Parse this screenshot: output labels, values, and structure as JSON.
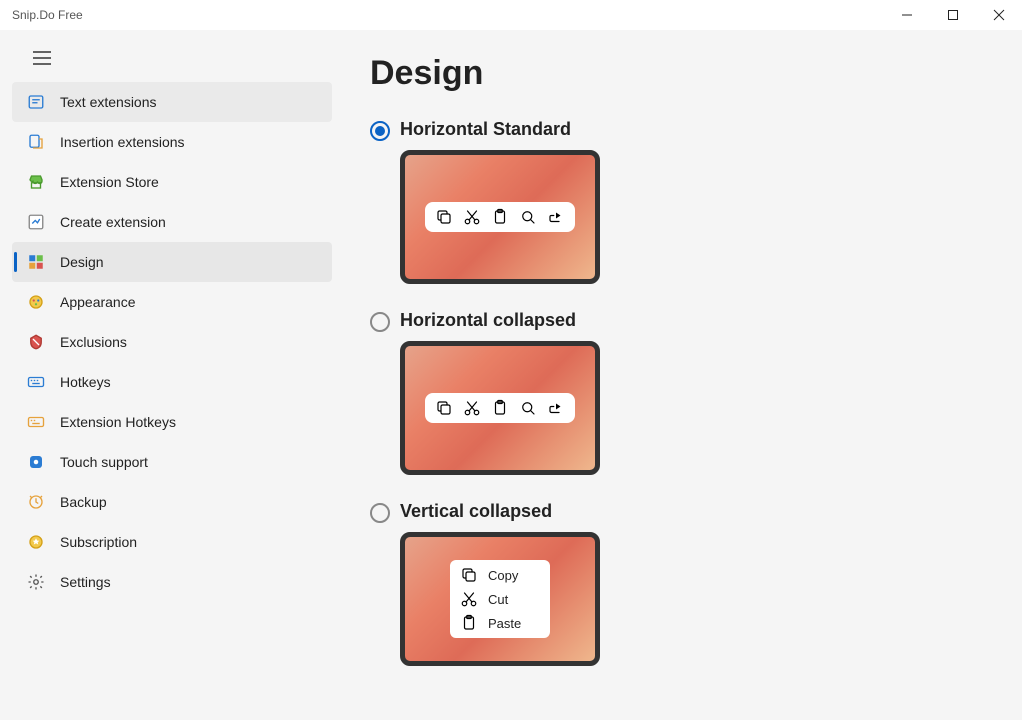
{
  "window": {
    "title": "Snip.Do Free"
  },
  "sidebar": {
    "items": [
      {
        "label": "Text extensions",
        "icon": "text-ext",
        "state": "hover"
      },
      {
        "label": "Insertion extensions",
        "icon": "insert-ext",
        "state": ""
      },
      {
        "label": "Extension Store",
        "icon": "store",
        "state": ""
      },
      {
        "label": "Create extension",
        "icon": "create",
        "state": ""
      },
      {
        "label": "Design",
        "icon": "design",
        "state": "selected"
      },
      {
        "label": "Appearance",
        "icon": "appearance",
        "state": ""
      },
      {
        "label": "Exclusions",
        "icon": "exclusions",
        "state": ""
      },
      {
        "label": "Hotkeys",
        "icon": "hotkeys",
        "state": ""
      },
      {
        "label": "Extension Hotkeys",
        "icon": "ext-hotkeys",
        "state": ""
      },
      {
        "label": "Touch support",
        "icon": "touch",
        "state": ""
      },
      {
        "label": "Backup",
        "icon": "backup",
        "state": ""
      },
      {
        "label": "Subscription",
        "icon": "subscription",
        "state": ""
      },
      {
        "label": "Settings",
        "icon": "settings",
        "state": ""
      }
    ]
  },
  "main": {
    "title": "Design",
    "options": [
      {
        "label": "Horizontal Standard",
        "selected": true,
        "preview": "horizontal"
      },
      {
        "label": "Horizontal collapsed",
        "selected": false,
        "preview": "horizontal"
      },
      {
        "label": "Vertical collapsed",
        "selected": false,
        "preview": "vertical"
      }
    ],
    "vertical_menu": [
      {
        "label": "Copy",
        "icon": "copy"
      },
      {
        "label": "Cut",
        "icon": "cut"
      },
      {
        "label": "Paste",
        "icon": "paste"
      }
    ]
  }
}
